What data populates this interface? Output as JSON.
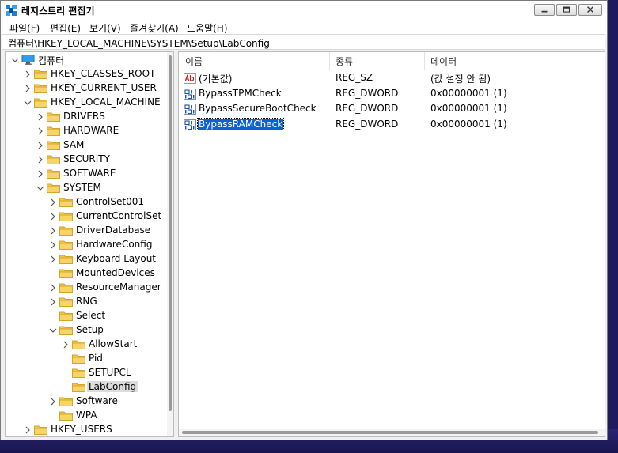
{
  "window": {
    "title": "레지스트리 편집기",
    "address": "컴퓨터\\HKEY_LOCAL_MACHINE\\SYSTEM\\Setup\\LabConfig"
  },
  "menu": [
    {
      "label": "파일(F)"
    },
    {
      "label": "편집(E)"
    },
    {
      "label": "보기(V)"
    },
    {
      "label": "즐겨찾기(A)"
    },
    {
      "label": "도움말(H)"
    }
  ],
  "tree": [
    {
      "label": "컴퓨터",
      "depth": 0,
      "state": "open",
      "icon": "computer-icon"
    },
    {
      "label": "HKEY_CLASSES_ROOT",
      "depth": 1,
      "state": "closed",
      "icon": "folder-icon"
    },
    {
      "label": "HKEY_CURRENT_USER",
      "depth": 1,
      "state": "closed",
      "icon": "folder-icon"
    },
    {
      "label": "HKEY_LOCAL_MACHINE",
      "depth": 1,
      "state": "open",
      "icon": "folder-icon"
    },
    {
      "label": "DRIVERS",
      "depth": 2,
      "state": "closed",
      "icon": "folder-icon"
    },
    {
      "label": "HARDWARE",
      "depth": 2,
      "state": "closed",
      "icon": "folder-icon"
    },
    {
      "label": "SAM",
      "depth": 2,
      "state": "closed",
      "icon": "folder-icon"
    },
    {
      "label": "SECURITY",
      "depth": 2,
      "state": "closed",
      "icon": "folder-icon"
    },
    {
      "label": "SOFTWARE",
      "depth": 2,
      "state": "closed",
      "icon": "folder-icon"
    },
    {
      "label": "SYSTEM",
      "depth": 2,
      "state": "open",
      "icon": "folder-icon"
    },
    {
      "label": "ControlSet001",
      "depth": 3,
      "state": "closed",
      "icon": "folder-icon"
    },
    {
      "label": "CurrentControlSet",
      "depth": 3,
      "state": "closed",
      "icon": "folder-icon"
    },
    {
      "label": "DriverDatabase",
      "depth": 3,
      "state": "closed",
      "icon": "folder-icon"
    },
    {
      "label": "HardwareConfig",
      "depth": 3,
      "state": "closed",
      "icon": "folder-icon"
    },
    {
      "label": "Keyboard Layout",
      "depth": 3,
      "state": "closed",
      "icon": "folder-icon"
    },
    {
      "label": "MountedDevices",
      "depth": 3,
      "state": "none",
      "icon": "folder-icon"
    },
    {
      "label": "ResourceManager",
      "depth": 3,
      "state": "closed",
      "icon": "folder-icon"
    },
    {
      "label": "RNG",
      "depth": 3,
      "state": "closed",
      "icon": "folder-icon"
    },
    {
      "label": "Select",
      "depth": 3,
      "state": "none",
      "icon": "folder-icon"
    },
    {
      "label": "Setup",
      "depth": 3,
      "state": "open",
      "icon": "folder-open-icon"
    },
    {
      "label": "AllowStart",
      "depth": 4,
      "state": "closed",
      "icon": "folder-icon"
    },
    {
      "label": "Pid",
      "depth": 4,
      "state": "none",
      "icon": "folder-icon"
    },
    {
      "label": "SETUPCL",
      "depth": 4,
      "state": "none",
      "icon": "folder-icon"
    },
    {
      "label": "LabConfig",
      "depth": 4,
      "state": "none",
      "icon": "folder-icon",
      "selected": true
    },
    {
      "label": "Software",
      "depth": 3,
      "state": "closed",
      "icon": "folder-icon"
    },
    {
      "label": "WPA",
      "depth": 3,
      "state": "none",
      "icon": "folder-icon"
    },
    {
      "label": "HKEY_USERS",
      "depth": 1,
      "state": "closed",
      "icon": "folder-icon"
    }
  ],
  "list": {
    "columns": [
      "이름",
      "종류",
      "데이터"
    ],
    "rows": [
      {
        "name": "(기본값)",
        "type": "REG_SZ",
        "data": "(값 설정 안 됨)",
        "icon": "string-value-icon"
      },
      {
        "name": "BypassTPMCheck",
        "type": "REG_DWORD",
        "data": "0x00000001 (1)",
        "icon": "binary-value-icon"
      },
      {
        "name": "BypassSecureBootCheck",
        "type": "REG_DWORD",
        "data": "0x00000001 (1)",
        "icon": "binary-value-icon"
      },
      {
        "name": "BypassRAMCheck",
        "type": "REG_DWORD",
        "data": "0x00000001 (1)",
        "icon": "binary-value-icon",
        "selected": true
      }
    ]
  },
  "colors": {
    "selection": "#0a63d4",
    "folder": "#f3c644",
    "tree_selection": "#dcdcdc"
  }
}
